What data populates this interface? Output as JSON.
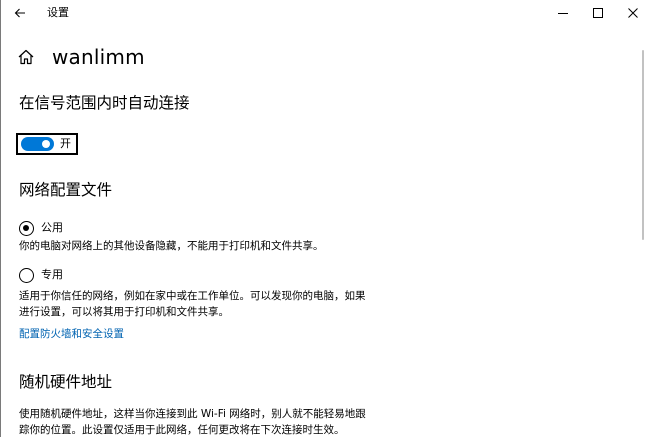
{
  "window": {
    "title": "设置"
  },
  "header": {
    "title": "wanlimm"
  },
  "auto_connect": {
    "title": "在信号范围内时自动连接",
    "toggle_state_label": "开",
    "toggle_on": true
  },
  "network_profile": {
    "title": "网络配置文件",
    "options": [
      {
        "label": "公用",
        "selected": true,
        "description": "你的电脑对网络上的其他设备隐藏，不能用于打印机和文件共享。"
      },
      {
        "label": "专用",
        "selected": false,
        "description": "适用于你信任的网络，例如在家中或在工作单位。可以发现你的电脑，如果进行设置，可以将其用于打印机和文件共享。"
      }
    ],
    "firewall_link": "配置防火墙和安全设置"
  },
  "random_hardware": {
    "title": "随机硬件地址",
    "description": "使用随机硬件地址，这样当你连接到此 Wi-Fi 网络时，别人就不能轻易地跟踪你的位置。此设置仅适用于此网络，任何更改将在下次连接时生效。"
  },
  "colors": {
    "accent": "#0078d7",
    "link": "#0063b1"
  },
  "icons": {
    "back": "back-arrow-icon",
    "home": "home-icon",
    "minimize": "minimize-icon",
    "maximize": "maximize-icon",
    "close": "close-icon"
  }
}
